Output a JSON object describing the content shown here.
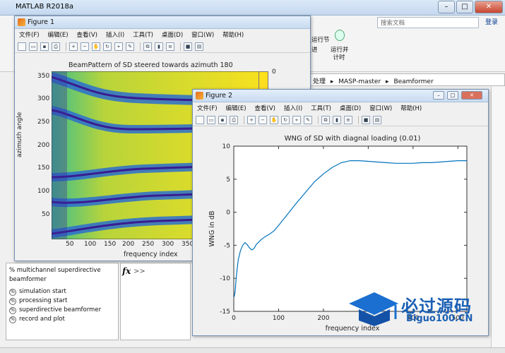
{
  "main_window": {
    "title": "MATLAB R2018a",
    "search_placeholder": "搜索文档",
    "login_label": "登录",
    "tool_label_1": "运行节\n进",
    "tool_label_2": "运行并\n计时",
    "path": [
      "处理",
      "▸",
      "MASP-master",
      "▸",
      "Beamformer"
    ],
    "outline_title": "% multichannel superdirective beamformer",
    "outline_items": [
      "simulation start",
      "processing start",
      "superdirective beamformer",
      "record and plot"
    ],
    "command_prompt": ">>"
  },
  "figure1": {
    "title": "Figure 1",
    "menu": [
      "文件(F)",
      "编辑(E)",
      "查看(V)",
      "插入(I)",
      "工具(T)",
      "桌面(D)",
      "窗口(W)",
      "帮助(H)"
    ],
    "plot_title": "BeamPattern of SD steered towards azimuth 180",
    "xlabel": "frequency index",
    "ylabel": "azimuth angle",
    "xticks": [
      "50",
      "100",
      "150",
      "200",
      "250",
      "300",
      "350"
    ],
    "yticks": [
      "350",
      "300",
      "250",
      "200",
      "150",
      "100",
      "50"
    ],
    "colorbar_top_label": "0"
  },
  "figure2": {
    "title": "Figure 2",
    "menu": [
      "文件(F)",
      "编辑(E)",
      "查看(V)",
      "插入(I)",
      "工具(T)",
      "桌面(D)",
      "窗口(W)",
      "帮助(H)"
    ]
  },
  "chart_data": {
    "type": "line",
    "title": "WNG of SD with diagnal loading (0.01)",
    "xlabel": "frequency index",
    "ylabel": "WNG in dB",
    "xlim": [
      0,
      520
    ],
    "ylim": [
      -15,
      10
    ],
    "xticks": [
      0,
      100,
      200,
      300,
      400,
      500
    ],
    "yticks": [
      10,
      5,
      0,
      -5,
      -10,
      -15
    ],
    "series": [
      {
        "color": "#0072bd",
        "x": [
          1,
          3,
          6,
          10,
          15,
          20,
          25,
          30,
          35,
          40,
          45,
          50,
          60,
          70,
          80,
          90,
          100,
          120,
          140,
          160,
          180,
          200,
          220,
          240,
          260,
          280,
          300,
          320,
          340,
          360,
          380,
          400,
          420,
          440,
          460,
          480,
          500,
          520
        ],
        "y": [
          -12.8,
          -12.0,
          -9.5,
          -7.2,
          -5.8,
          -5.0,
          -4.6,
          -4.9,
          -5.4,
          -5.7,
          -5.5,
          -4.9,
          -4.2,
          -3.7,
          -3.3,
          -2.8,
          -2.0,
          -0.3,
          1.4,
          3.0,
          4.6,
          5.8,
          6.8,
          7.5,
          7.8,
          7.8,
          7.7,
          7.6,
          7.5,
          7.4,
          7.4,
          7.4,
          7.5,
          7.5,
          7.6,
          7.7,
          7.8,
          7.8
        ]
      }
    ]
  },
  "watermark": {
    "text": "必过源码",
    "sub": "Biguo100.CN"
  }
}
